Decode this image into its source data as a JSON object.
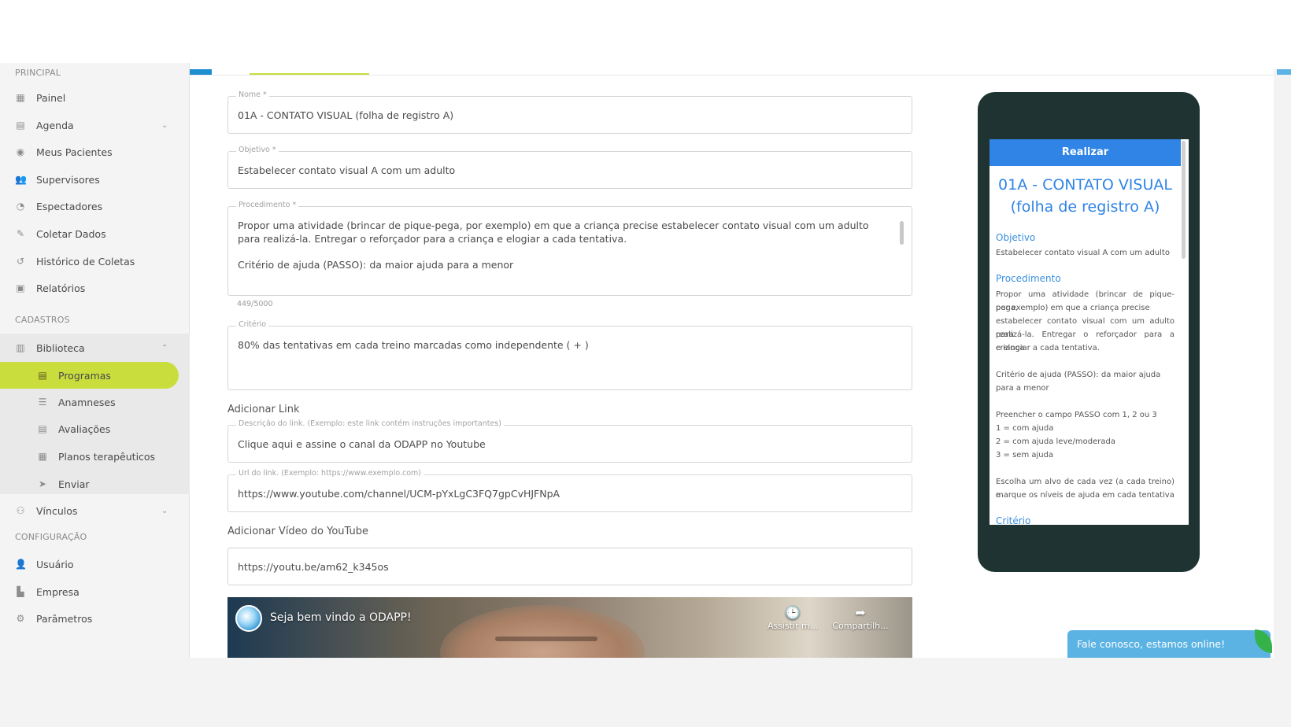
{
  "sidebar": {
    "sections": {
      "principal": "PRINCIPAL",
      "cadastros": "CADASTROS",
      "configuracao": "CONFIGURAÇÃO"
    },
    "items": {
      "painel": "Painel",
      "agenda": "Agenda",
      "meus_pacientes": "Meus Pacientes",
      "supervisores": "Supervisores",
      "espectadores": "Espectadores",
      "coletar_dados": "Coletar Dados",
      "historico": "Histórico de Coletas",
      "relatorios": "Relatórios",
      "biblioteca": "Biblioteca",
      "programas": "Programas",
      "anamneses": "Anamneses",
      "avaliacoes": "Avaliações",
      "planos": "Planos terapêuticos",
      "enviar": "Enviar",
      "vinculos": "Vínculos",
      "usuario": "Usuário",
      "empresa": "Empresa",
      "parametros": "Parâmetros"
    },
    "active_item": "Programas",
    "accent_color": "#c9de3c"
  },
  "form": {
    "nome": {
      "label": "Nome *",
      "value": "01A - CONTATO VISUAL (folha de registro A)"
    },
    "objetivo": {
      "label": "Objetivo *",
      "value": "Estabelecer contato visual A com um adulto"
    },
    "procedimento": {
      "label": "Procedimento *",
      "line1": "Propor uma atividade (brincar de pique-pega, por exemplo) em que a criança precise estabelecer contato visual com um adulto",
      "line2": "para realizá-la. Entregar o reforçador para a criança e elogiar a cada tentativa.",
      "line3": "Critério de ajuda (PASSO): da maior ajuda para a menor",
      "counter": "449/5000"
    },
    "criterio": {
      "label": "Critério",
      "value": "80% das tentativas em cada treino marcadas como independente ( + )"
    },
    "link_heading": "Adicionar Link",
    "link_desc": {
      "label": "Descrição do link. (Exemplo: este link contém instruções importantes)",
      "value": "Clique aqui e assine o canal da ODAPP no Youtube"
    },
    "link_url": {
      "label": "Url do link. (Exemplo: https://www.exemplo.com)",
      "value": "https://www.youtube.com/channel/UCM-pYxLgC3FQ7gpCvHJFNpA"
    },
    "video_heading": "Adicionar Vídeo do YouTube",
    "video_url": "https://youtu.be/am62_k345os"
  },
  "video": {
    "title": "Seja bem vindo a ODAPP!",
    "watch_later": "Assistir m...",
    "share": "Compartilh..."
  },
  "preview": {
    "button": "Realizar",
    "title_line1": "01A - CONTATO VISUAL",
    "title_line2": "(folha de registro A)",
    "objetivo_h": "Objetivo",
    "objetivo_t": "Estabelecer contato visual A com um adulto",
    "procedimento_h": "Procedimento",
    "proc_l1": "Propor uma atividade (brincar de pique-pega,",
    "proc_l2": "por exemplo) em que a criança precise",
    "proc_l3": "estabelecer contato visual com um adulto para",
    "proc_l4": "realizá-la. Entregar o reforçador para a criança",
    "proc_l5": "e elogiar a cada tentativa.",
    "crit_l1": "Critério de ajuda (PASSO): da maior ajuda",
    "crit_l2": "para a menor",
    "passo_l1": "Preencher o campo PASSO com 1, 2 ou 3",
    "passo_l2": "1 = com ajuda",
    "passo_l3": "2 = com ajuda leve/moderada",
    "passo_l4": "3 = sem ajuda",
    "alvo_l1": "Escolha um alvo de cada vez (a cada treino) e",
    "alvo_l2": "marque os níveis de ajuda em cada tentativa",
    "criterio_h": "Critério",
    "accent_color": "#2f84e6"
  },
  "chat": {
    "label": "Fale conosco, estamos online!"
  }
}
